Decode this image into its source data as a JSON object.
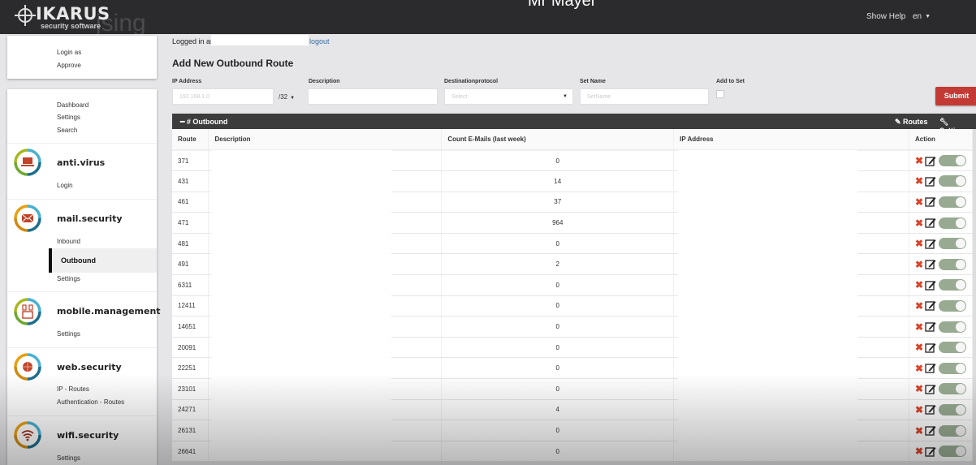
{
  "header": {
    "brand": "IKARUS",
    "brand_sub": "security software",
    "watermark": "jsing",
    "user_title": "Mr Mayer",
    "show_help": "Show Help",
    "language": "en"
  },
  "sidebar": {
    "top_card": [
      "Login as",
      "Approve"
    ],
    "general": [
      "Dashboard",
      "Settings",
      "Search"
    ],
    "sections": [
      {
        "title": "anti.virus",
        "icon": "laptop-icon",
        "items": [
          "Login"
        ]
      },
      {
        "title": "mail.security",
        "icon": "envelope-icon",
        "items": [
          "Inbound",
          "Outbound",
          "Settings"
        ],
        "active": "Outbound"
      },
      {
        "title": "mobile.management",
        "icon": "mobile-devices-icon",
        "items": [
          "Settings"
        ]
      },
      {
        "title": "web.security",
        "icon": "globe-icon",
        "items": [
          "IP - Routes",
          "Authentication - Routes"
        ]
      },
      {
        "title": "wifi.security",
        "icon": "wifi-icon",
        "items": [
          "Settings"
        ]
      }
    ]
  },
  "main": {
    "logged_in_label": "Logged in as:",
    "logout": "logout",
    "page_title": "Add New Outbound Route",
    "form": {
      "ip_label": "IP Address",
      "ip_placeholder": "192.168.1.0",
      "prefix": "/32",
      "description_label": "Description",
      "description_value": "",
      "protocol_label": "Destinationprotocol",
      "protocol_selected": "Select",
      "setname_label": "Set Name",
      "setname_placeholder": "SetName",
      "addtoset_label": "Add to Set",
      "addtoset_checked": false,
      "submit": "Submit"
    },
    "panel": {
      "title": "# Outbound",
      "routes_btn": "Routes",
      "settings_btn": "Settings"
    },
    "table": {
      "columns": [
        "Route",
        "Description",
        "Count E-Mails (last week)",
        "IP Address",
        "Action"
      ],
      "rows": [
        {
          "route": "371",
          "count": "0",
          "enabled": true
        },
        {
          "route": "431",
          "count": "14",
          "enabled": true
        },
        {
          "route": "461",
          "count": "37",
          "enabled": true
        },
        {
          "route": "471",
          "count": "964",
          "enabled": true
        },
        {
          "route": "481",
          "count": "0",
          "enabled": true
        },
        {
          "route": "491",
          "count": "2",
          "enabled": true
        },
        {
          "route": "6311",
          "count": "0",
          "enabled": true
        },
        {
          "route": "12411",
          "count": "0",
          "enabled": true
        },
        {
          "route": "14651",
          "count": "0",
          "enabled": true
        },
        {
          "route": "20091",
          "count": "0",
          "enabled": true
        },
        {
          "route": "22251",
          "count": "0",
          "enabled": true
        },
        {
          "route": "23101",
          "count": "0",
          "enabled": true
        },
        {
          "route": "24271",
          "count": "4",
          "enabled": true
        },
        {
          "route": "26131",
          "count": "0",
          "enabled": true
        },
        {
          "route": "26641",
          "count": "0",
          "enabled": true
        }
      ]
    }
  },
  "colors": {
    "topbar": "#2b2b2d",
    "submit": "#c33a35",
    "delete": "#d9442a",
    "toggle_on": "#98ab92",
    "link": "#3a6ea5"
  }
}
